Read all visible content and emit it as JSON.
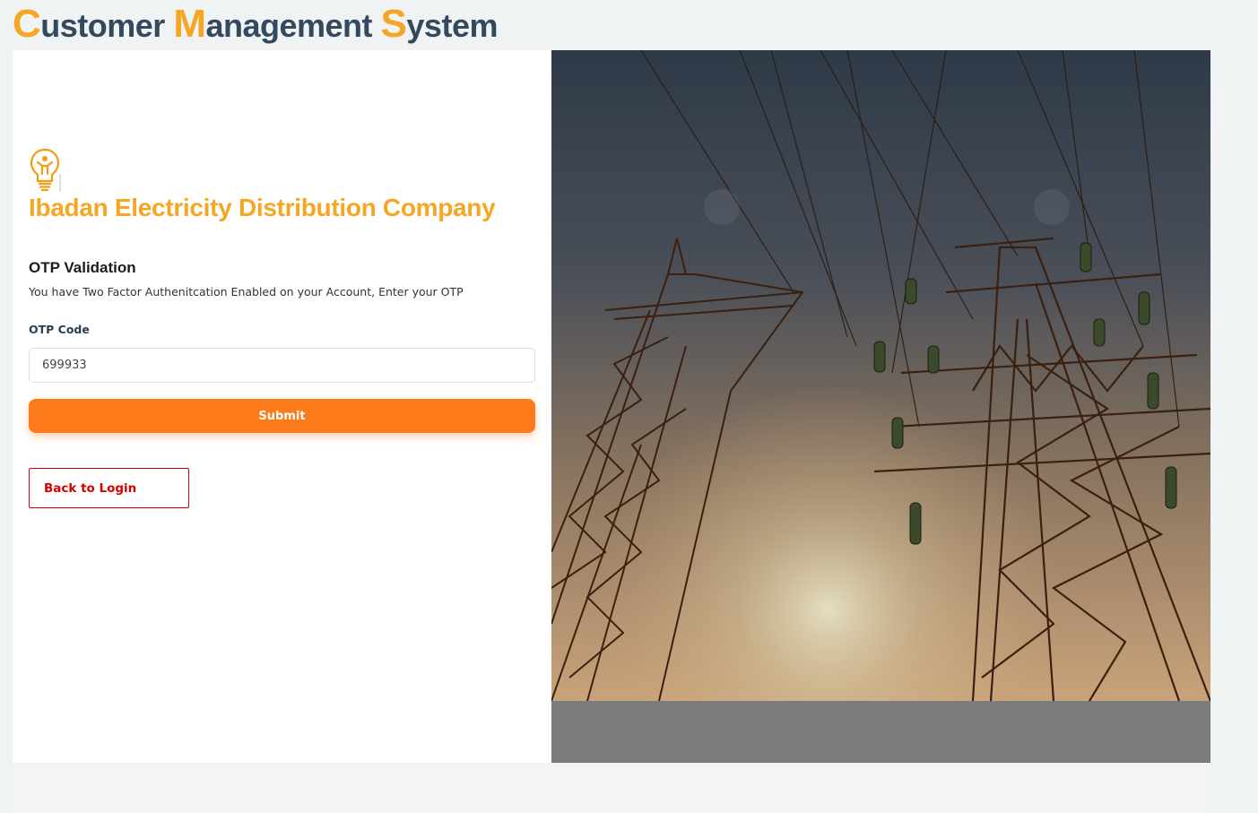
{
  "header": {
    "title_parts": [
      {
        "initial": "C",
        "rest": "ustomer "
      },
      {
        "initial": "M",
        "rest": "anagement "
      },
      {
        "initial": "S",
        "rest": "ystem"
      }
    ]
  },
  "brand": {
    "logo_icon": "lightbulb-person-icon",
    "company_name": "Ibadan Electricity Distribution Company",
    "accent_color": "#f5a623"
  },
  "otp": {
    "title": "OTP Validation",
    "description": "You have Two Factor Authenitcation Enabled on your Account, Enter your OTP",
    "field_label": "OTP Code",
    "field_value": "699933",
    "submit_label": "Submit",
    "submit_color": "#fd7a1b"
  },
  "back": {
    "label": "Back to Login",
    "color": "#d50000"
  },
  "hero": {
    "description_icon": "power-transmission-towers-image"
  }
}
